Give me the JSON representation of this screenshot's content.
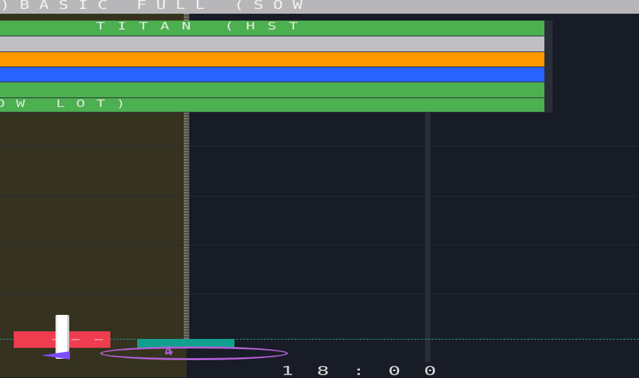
{
  "header": {
    "title": ")BASIC FULL (SOW"
  },
  "legend": {
    "title": "TITAN (HST",
    "bottom_label": "OW LOT)",
    "band_colors": [
      "#c0c0c4",
      "#ff9800",
      "#2962ff",
      "#4caf50"
    ]
  },
  "markers": {
    "ellipse_label": "4"
  },
  "axis": {
    "time_label": "18:00"
  },
  "colors": {
    "background": "#181c26",
    "shaded_region": "#35331f",
    "price_line": "#1fa3a0",
    "bear_marker": "#ef3c4f",
    "bull_marker": "#12a08e",
    "drawing_tool": "#b15fd6"
  }
}
